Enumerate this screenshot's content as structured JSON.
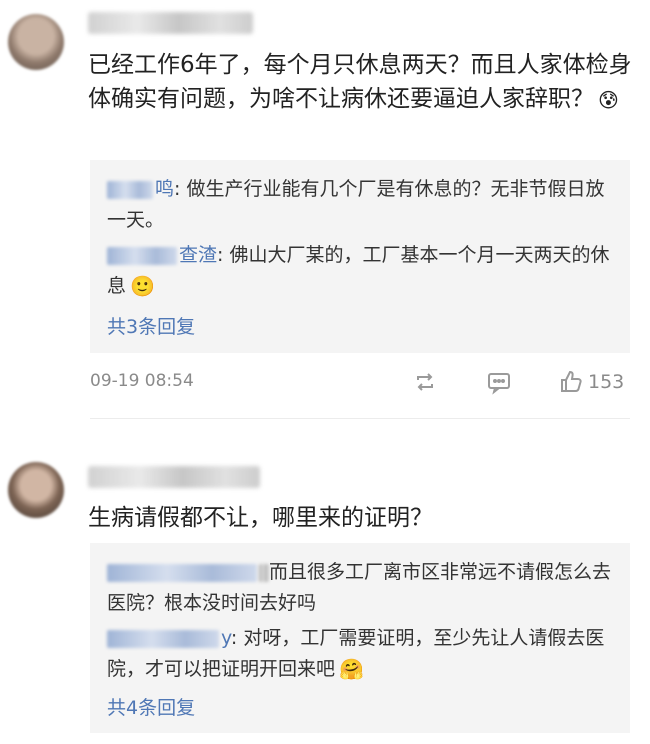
{
  "comments": [
    {
      "text": "已经工作6年了，每个月只休息两天？而且人家体检身体确实有问题，为啥不让病休还要逼迫人家辞职？",
      "emoji": "😰",
      "replies": [
        {
          "name_suffix": "鸣",
          "text": ": 做生产行业能有几个厂是有休息的？无非节假日放一天。"
        },
        {
          "name_suffix": "查渣",
          "text": ": 佛山大厂某的，工厂基本一个月一天两天的休息",
          "emoji": "🙂"
        }
      ],
      "more_replies": "共3条回复",
      "time": "09-19 08:54",
      "likes": "153"
    },
    {
      "text": "生病请假都不让，哪里来的证明？",
      "replies": [
        {
          "name_suffix": "",
          "text": "而且很多工厂离市区非常远不请假怎么去医院？根本没时间去好吗"
        },
        {
          "name_suffix": "y",
          "text": ": 对呀，工厂需要证明，至少先让人请假去医院，才可以把证明开回来吧",
          "emoji": "🤗"
        }
      ],
      "more_replies": "共4条回复"
    }
  ]
}
